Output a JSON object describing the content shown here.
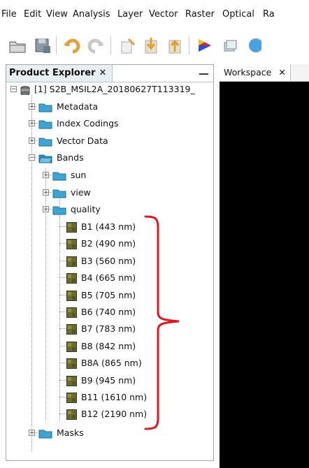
{
  "menubar": {
    "items": [
      "File",
      "Edit",
      "View",
      "Analysis",
      "Layer",
      "Vector",
      "Raster",
      "Optical",
      "Ra"
    ]
  },
  "toolbar": {
    "icons": [
      "open-product-icon",
      "save-product-icon",
      "undo-icon",
      "redo-icon",
      "band-maths-icon",
      "import-vector-icon",
      "export-icon",
      "rgb-image-icon",
      "layer-icon",
      "world-view-icon"
    ]
  },
  "product_explorer": {
    "tab_label": "Product Explorer",
    "close_glyph": "✕",
    "minimize_glyph": "—",
    "product": "[1] S2B_MSIL2A_20180627T113319_",
    "nodes": {
      "metadata": "Metadata",
      "index_codings": "Index Codings",
      "vector_data": "Vector Data",
      "bands": "Bands",
      "sun": "sun",
      "view": "view",
      "quality": "quality",
      "masks": "Masks"
    },
    "band_items": [
      "B1 (443 nm)",
      "B2 (490 nm)",
      "B3 (560 nm)",
      "B4 (665 nm)",
      "B5 (705 nm)",
      "B6 (740 nm)",
      "B7 (783 nm)",
      "B8 (842 nm)",
      "B8A (865 nm)",
      "B9 (945 nm)",
      "B11 (1610 nm)",
      "B12 (2190 nm)"
    ]
  },
  "workspace": {
    "tab_label": "Workspace",
    "close_glyph": "✕"
  },
  "colors": {
    "annotation_bracket": "#e8141c",
    "folder": "#1c95c8",
    "band_icon": "#6b6b2a"
  }
}
